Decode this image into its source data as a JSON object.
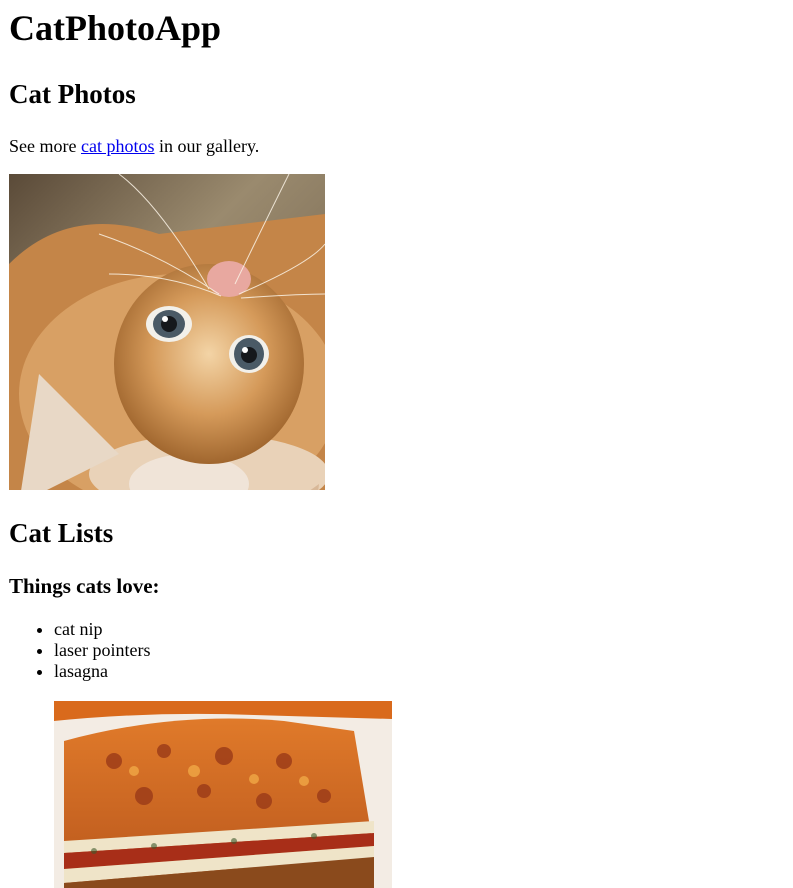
{
  "header": {
    "title": "CatPhotoApp"
  },
  "photos_section": {
    "heading": "Cat Photos",
    "text_before": "See more ",
    "link_text": "cat photos",
    "text_after": " in our gallery.",
    "image_alt": "A cute orange cat lying on its back."
  },
  "lists_section": {
    "heading": "Cat Lists",
    "subheading": "Things cats love:",
    "items": [
      "cat nip",
      "laser pointers",
      "lasagna"
    ],
    "image_alt": "A slice of lasagna on a plate."
  },
  "colors": {
    "link": "#0000ee",
    "text": "#000000",
    "background": "#ffffff"
  }
}
